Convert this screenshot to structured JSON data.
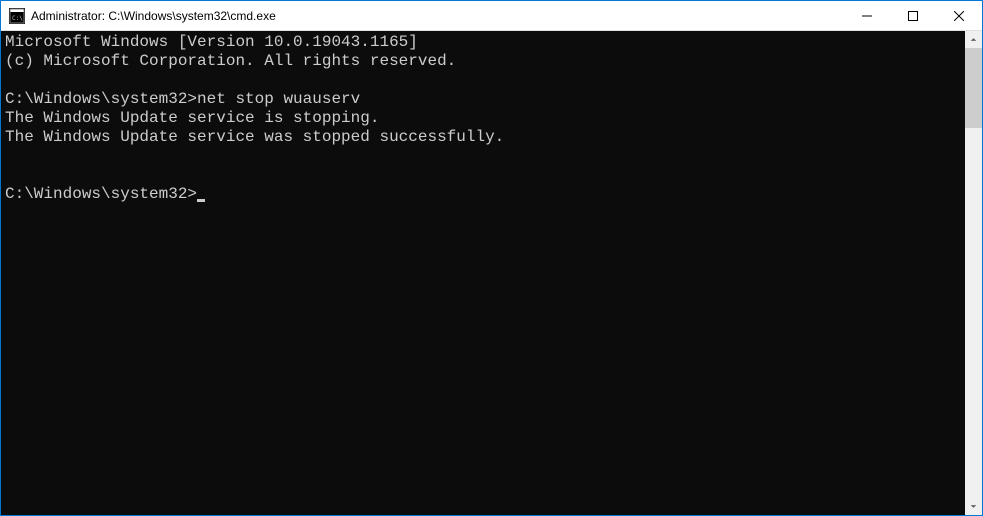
{
  "titlebar": {
    "title": "Administrator: C:\\Windows\\system32\\cmd.exe"
  },
  "terminal": {
    "lines": [
      "Microsoft Windows [Version 10.0.19043.1165]",
      "(c) Microsoft Corporation. All rights reserved.",
      "",
      "C:\\Windows\\system32>net stop wuauserv",
      "The Windows Update service is stopping.",
      "The Windows Update service was stopped successfully.",
      "",
      ""
    ],
    "prompt": "C:\\Windows\\system32>"
  }
}
